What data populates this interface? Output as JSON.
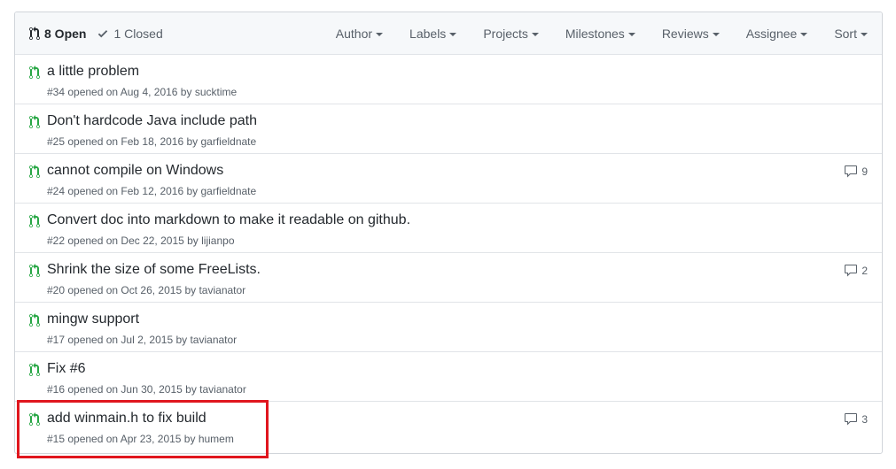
{
  "states": {
    "open_label": "8 Open",
    "closed_label": "1 Closed"
  },
  "filters": [
    {
      "label": "Author"
    },
    {
      "label": "Labels"
    },
    {
      "label": "Projects"
    },
    {
      "label": "Milestones"
    },
    {
      "label": "Reviews"
    },
    {
      "label": "Assignee"
    },
    {
      "label": "Sort"
    }
  ],
  "colors": {
    "open_green": "#28a745",
    "highlight_red": "#e0161e"
  },
  "pull_requests": [
    {
      "title": "a little problem",
      "meta": "#34 opened on Aug 4, 2016 by sucktime",
      "comments": ""
    },
    {
      "title": "Don't hardcode Java include path",
      "meta": "#25 opened on Feb 18, 2016 by garfieldnate",
      "comments": ""
    },
    {
      "title": "cannot compile on Windows",
      "meta": "#24 opened on Feb 12, 2016 by garfieldnate",
      "comments": "9"
    },
    {
      "title": "Convert doc into markdown to make it readable on github.",
      "meta": "#22 opened on Dec 22, 2015 by lijianpo",
      "comments": ""
    },
    {
      "title": "Shrink the size of some FreeLists.",
      "meta": "#20 opened on Oct 26, 2015 by tavianator",
      "comments": "2"
    },
    {
      "title": "mingw support",
      "meta": "#17 opened on Jul 2, 2015 by tavianator",
      "comments": ""
    },
    {
      "title": "Fix #6",
      "meta": "#16 opened on Jun 30, 2015 by tavianator",
      "comments": ""
    },
    {
      "title": "add winmain.h to fix build",
      "meta": "#15 opened on Apr 23, 2015 by humem",
      "comments": "3"
    }
  ]
}
